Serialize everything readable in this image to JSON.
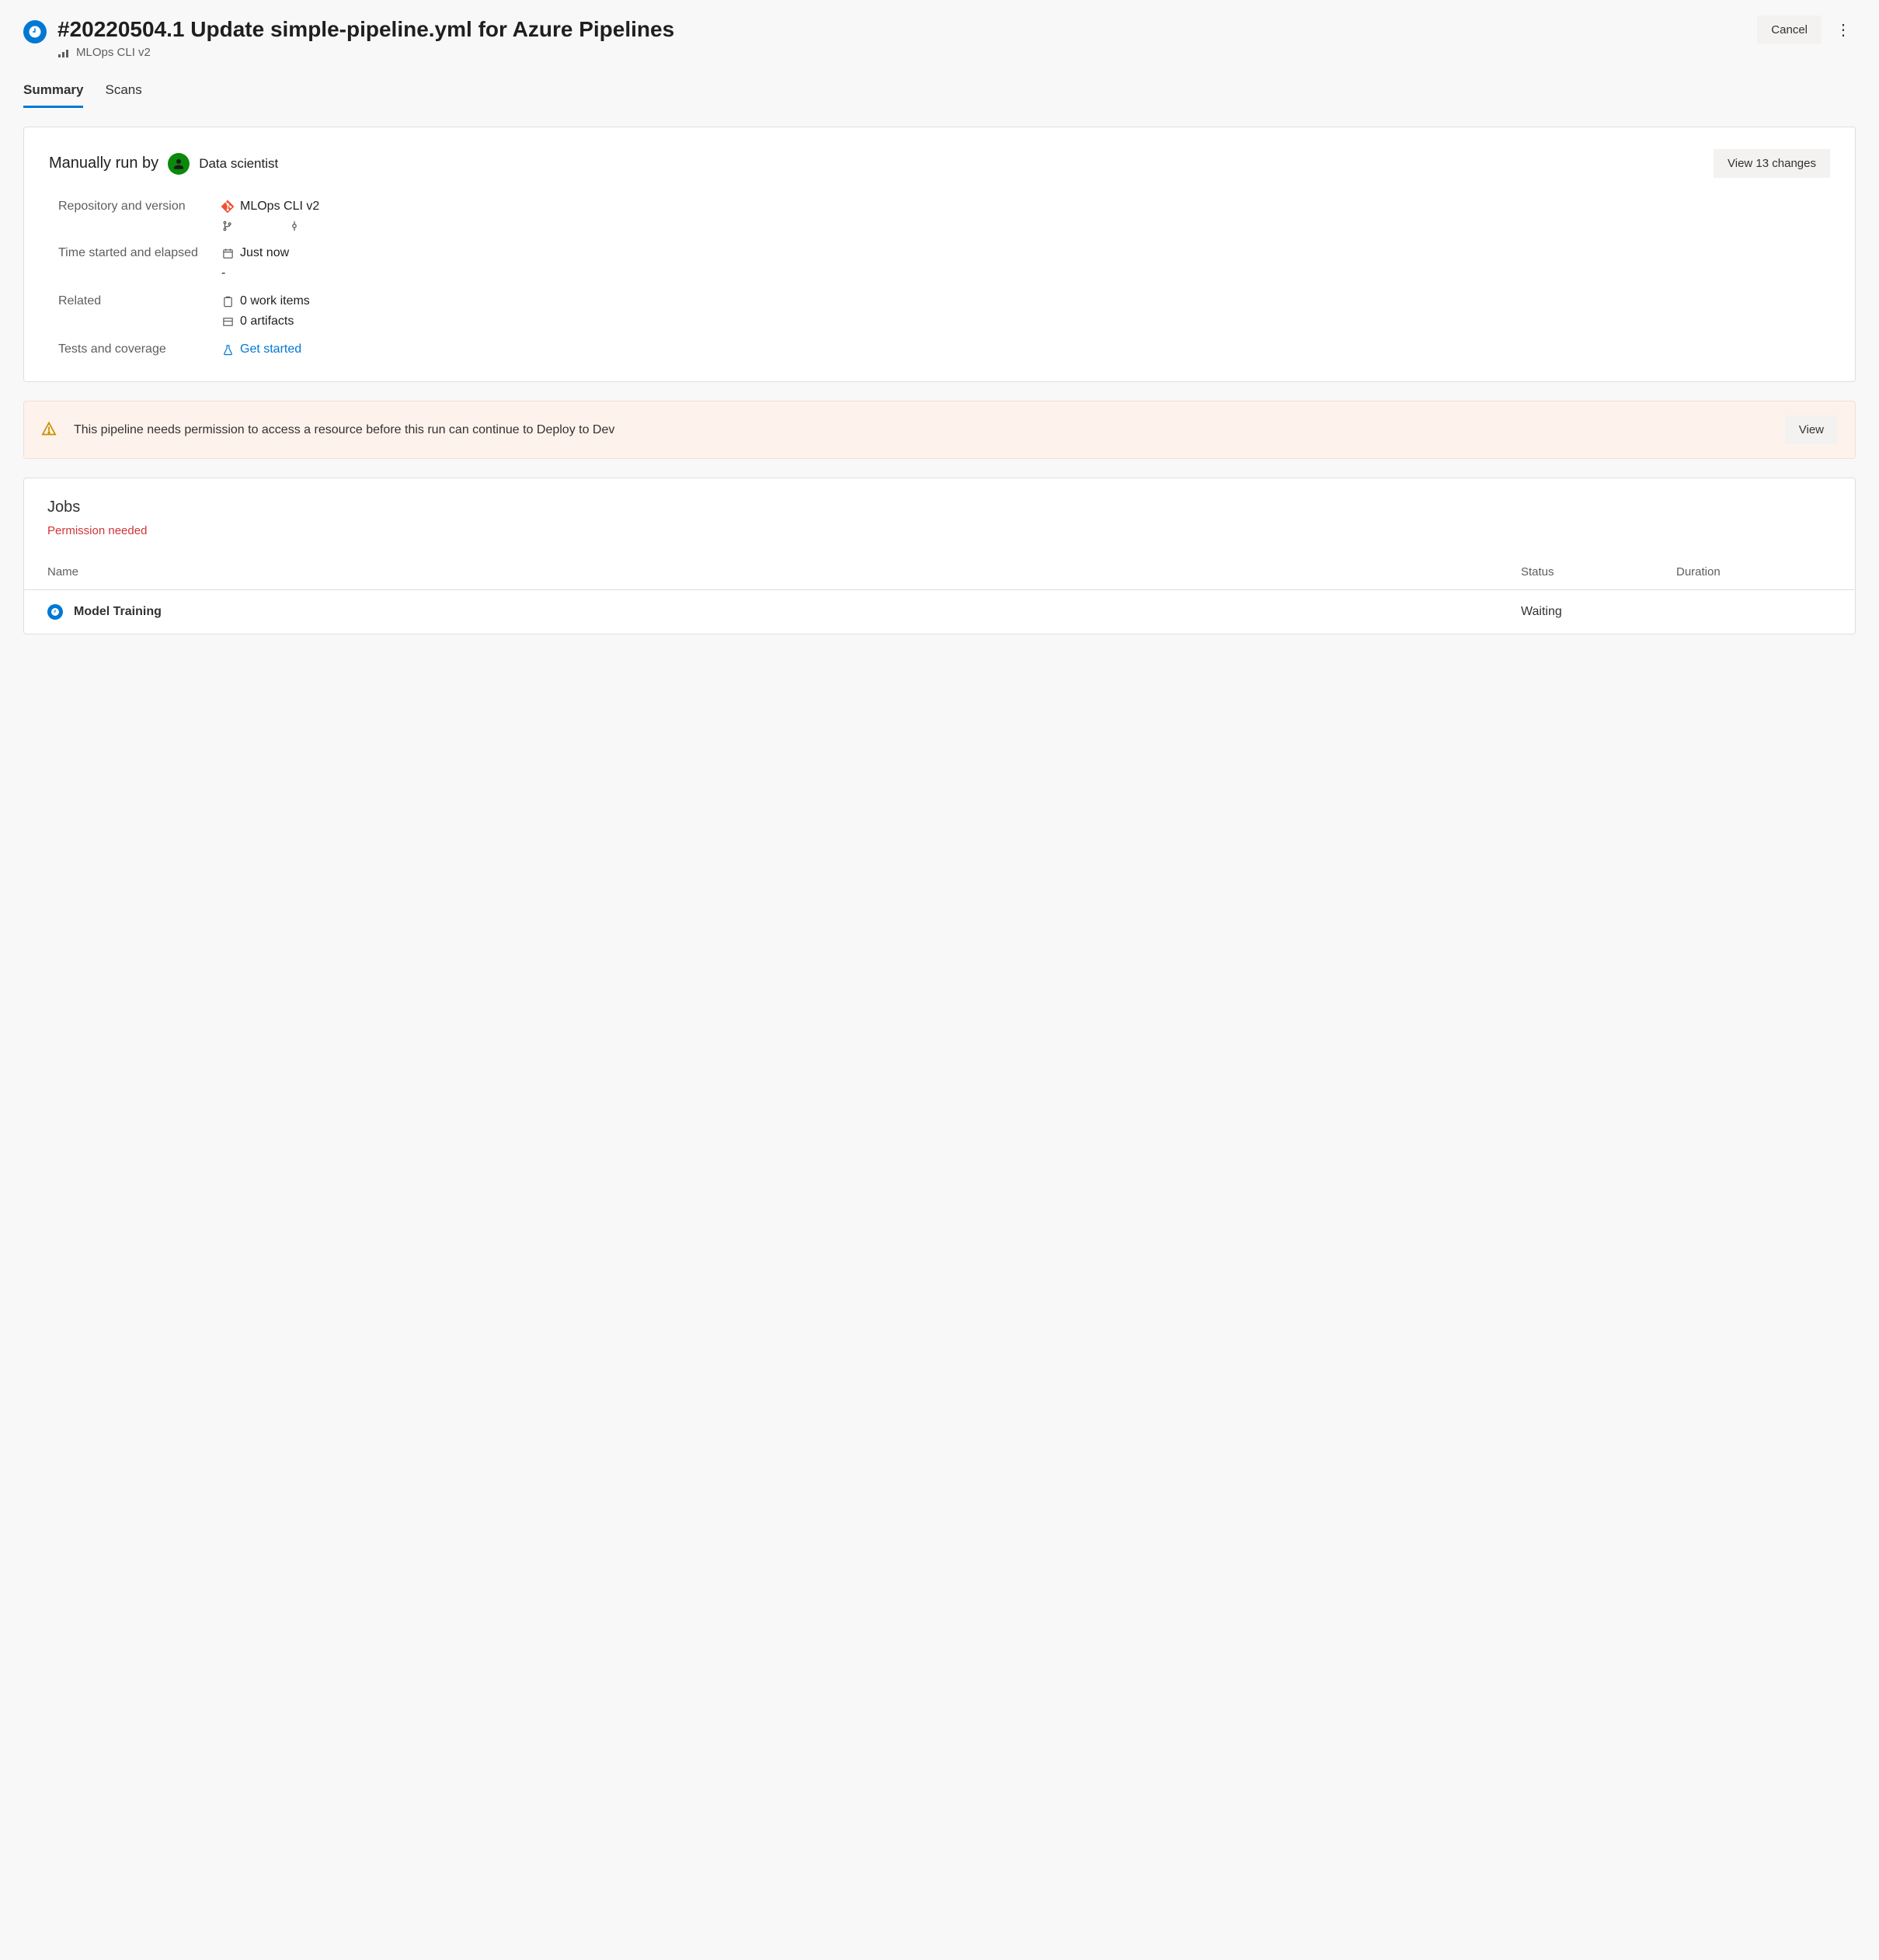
{
  "header": {
    "title": "#20220504.1 Update simple-pipeline.yml for Azure Pipelines",
    "pipeline_name": "MLOps CLI v2",
    "cancel_label": "Cancel"
  },
  "tabs": [
    {
      "label": "Summary",
      "active": true
    },
    {
      "label": "Scans",
      "active": false
    }
  ],
  "summary": {
    "run_by_prefix": "Manually run by",
    "run_by_user": "Data scientist",
    "view_changes_label": "View 13 changes",
    "details": {
      "repo_label": "Repository and version",
      "repo_name": "MLOps CLI v2",
      "time_label": "Time started and elapsed",
      "time_started": "Just now",
      "time_elapsed": "-",
      "related_label": "Related",
      "work_items": "0 work items",
      "artifacts": "0 artifacts",
      "tests_label": "Tests and coverage",
      "tests_link": "Get started"
    }
  },
  "alert": {
    "message": "This pipeline needs permission to access a resource before this run can continue to Deploy to Dev",
    "view_label": "View"
  },
  "jobs": {
    "title": "Jobs",
    "permission_text": "Permission needed",
    "columns": {
      "name": "Name",
      "status": "Status",
      "duration": "Duration"
    },
    "rows": [
      {
        "name": "Model Training",
        "status": "Waiting",
        "duration": ""
      }
    ]
  }
}
